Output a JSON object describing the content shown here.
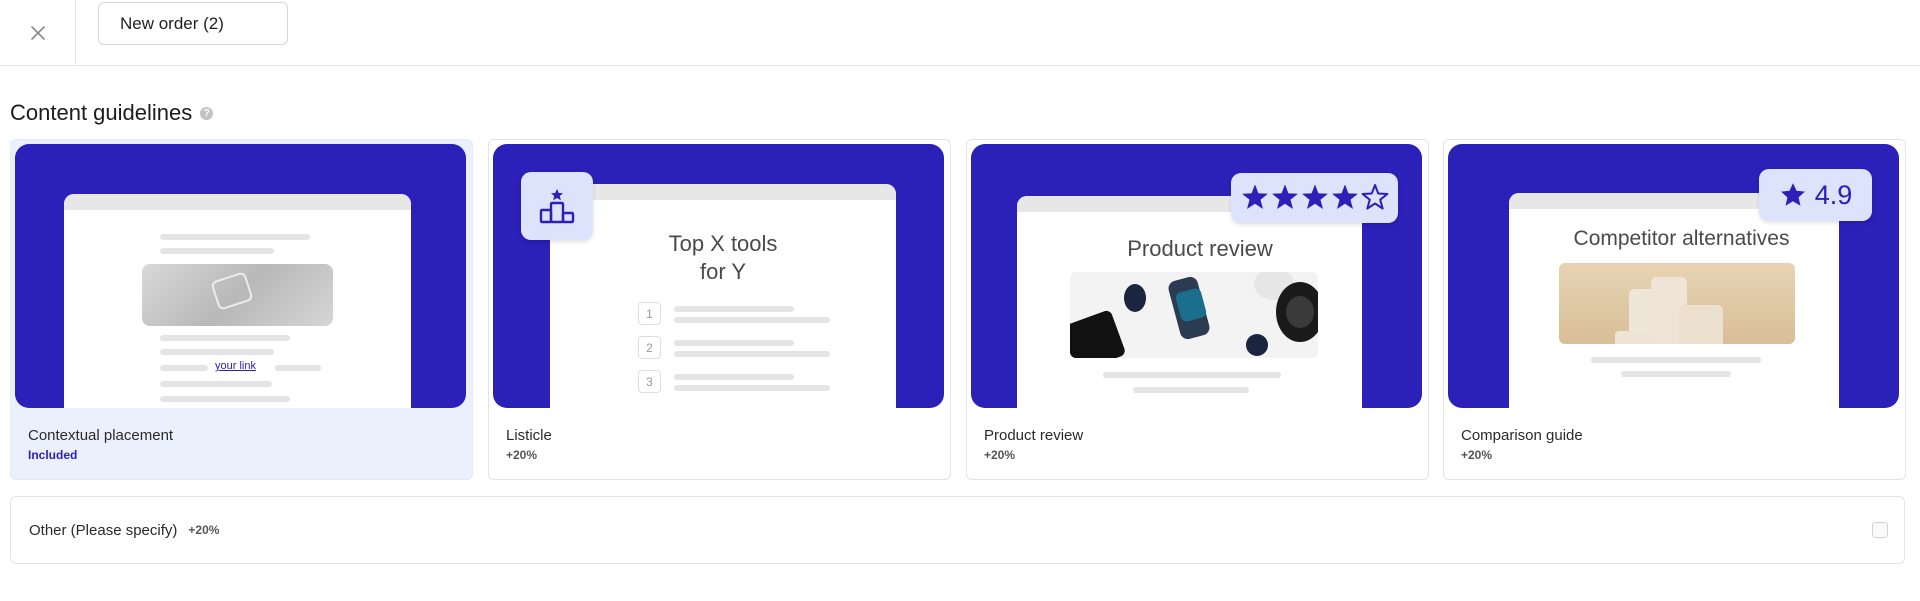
{
  "header": {
    "close_icon": "close-icon",
    "order_tab_label": "New order (2)"
  },
  "section": {
    "title": "Content guidelines",
    "help_icon": "?"
  },
  "cards": [
    {
      "title": "Contextual placement",
      "price": "Included",
      "selected": true,
      "art": {
        "link_text": "your link"
      }
    },
    {
      "title": "Listicle",
      "price": "+20%",
      "selected": false,
      "art": {
        "heading_line1": "Top X tools",
        "heading_line2": "for Y",
        "numbers": [
          "1",
          "2",
          "3"
        ],
        "badge_icon": "podium-icon"
      }
    },
    {
      "title": "Product review",
      "price": "+20%",
      "selected": false,
      "art": {
        "heading": "Product review",
        "rating_stars": 4,
        "rating_max": 5
      }
    },
    {
      "title": "Comparison guide",
      "price": "+20%",
      "selected": false,
      "art": {
        "heading": "Competitor alternatives",
        "rating": "4.9"
      }
    }
  ],
  "other": {
    "label": "Other (Please specify)",
    "price": "+20%"
  },
  "colors": {
    "accent": "#2b20b8",
    "badge_bg": "#dde3fb",
    "selected_bg": "#eaf1fc"
  }
}
